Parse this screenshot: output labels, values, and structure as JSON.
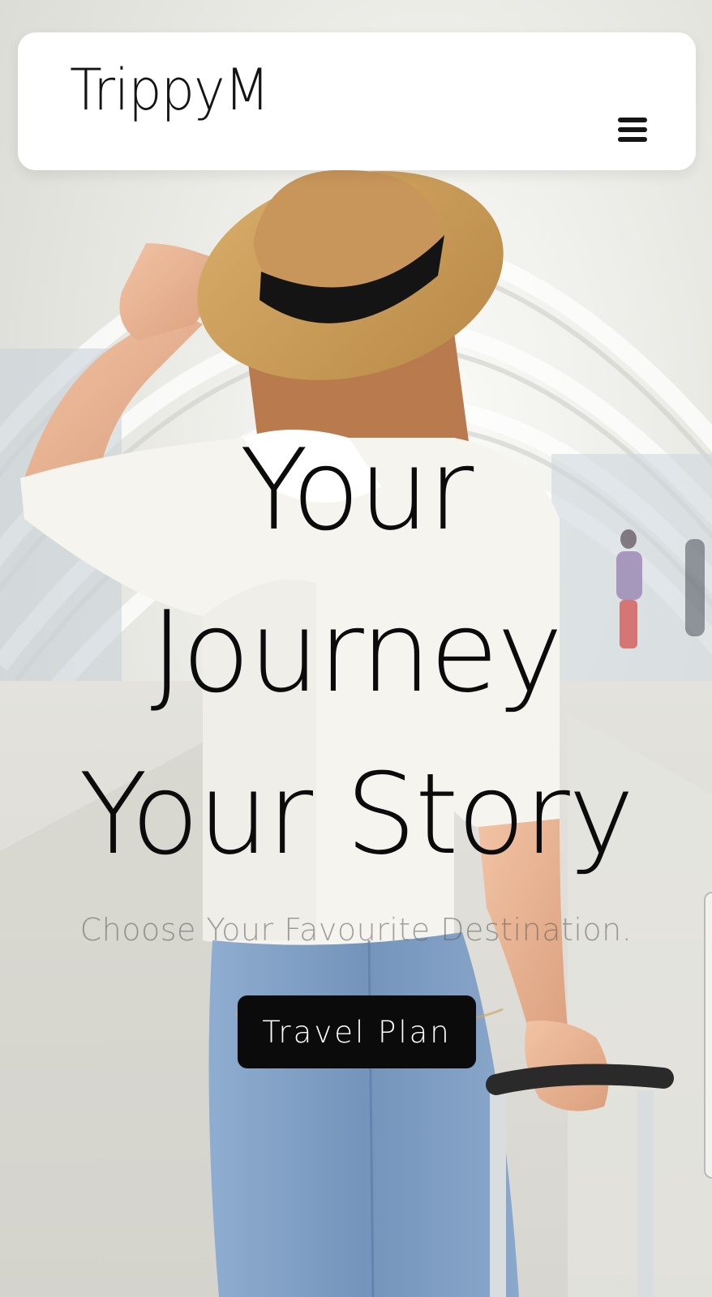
{
  "header": {
    "brand": "TrippyM",
    "menu_icon": "hamburger-menu-icon"
  },
  "hero": {
    "lines": [
      "Your",
      "Journey",
      "Your Story"
    ],
    "subtitle": "Choose Your Favourite Destination.",
    "cta_label": "Travel Plan"
  },
  "background": {
    "image": "traveler-with-straw-hat-and-suitcase-in-airport-corridor"
  },
  "colors": {
    "accent": "#0b0b0b",
    "header_bg": "#ffffff",
    "hat": "#c99a55",
    "shirt": "#f5f3ee",
    "jeans": "#7f9fc2"
  }
}
